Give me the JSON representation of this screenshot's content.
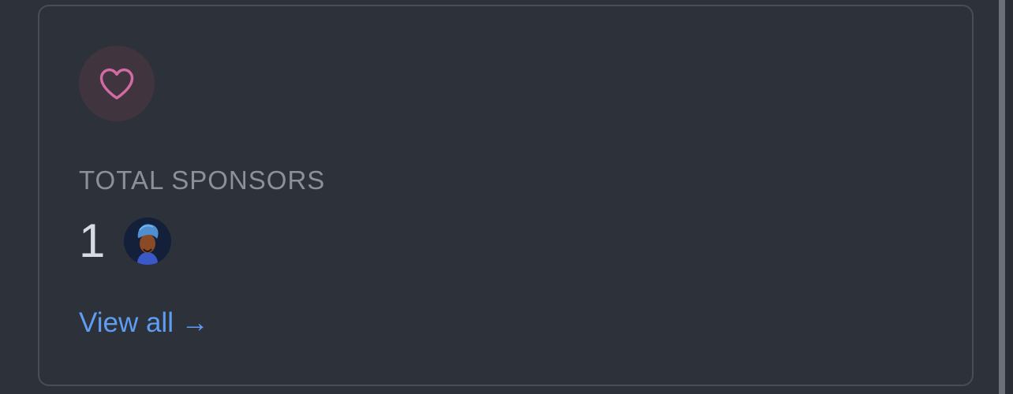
{
  "card": {
    "icon": "heart-icon",
    "label": "TOTAL SPONSORS",
    "count": "1",
    "sponsors": [
      {
        "avatar": "sponsor-avatar"
      }
    ],
    "link_label": "View all →"
  },
  "colors": {
    "background": "#2d3139",
    "card_border": "#484d57",
    "icon_circle": "#40353f",
    "heart": "#d26aa4",
    "label": "#8b919b",
    "count": "#d7dce3",
    "link": "#5f9df2"
  }
}
